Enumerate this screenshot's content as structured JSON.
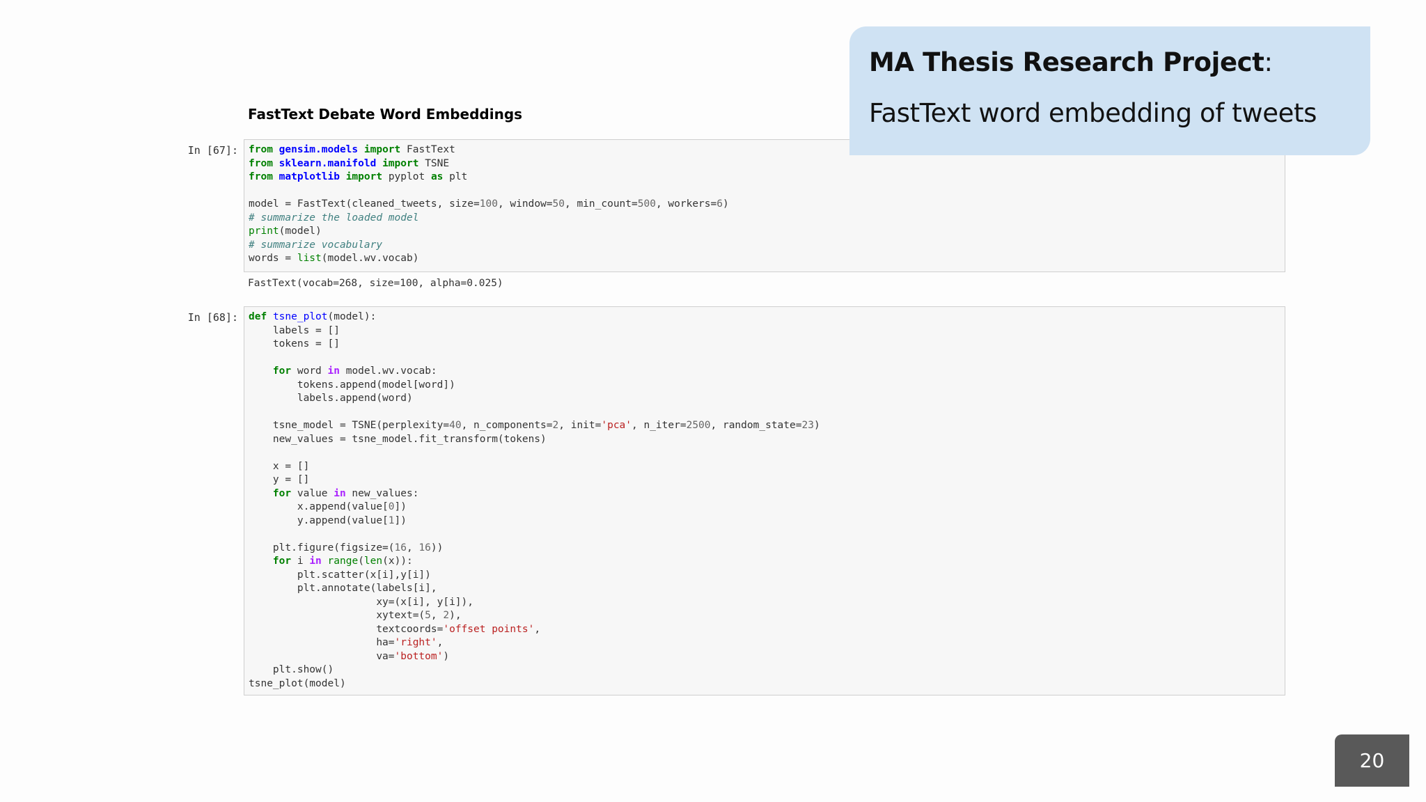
{
  "notebook": {
    "heading": "FastText Debate Word Embeddings",
    "cells": [
      {
        "prompt": "In [67]:",
        "lines": [
          [
            [
              "kw",
              "from"
            ],
            [
              "pl",
              " "
            ],
            [
              "mod",
              "gensim.models"
            ],
            [
              "pl",
              " "
            ],
            [
              "kw",
              "import"
            ],
            [
              "pl",
              " FastText"
            ]
          ],
          [
            [
              "kw",
              "from"
            ],
            [
              "pl",
              " "
            ],
            [
              "mod",
              "sklearn.manifold"
            ],
            [
              "pl",
              " "
            ],
            [
              "kw",
              "import"
            ],
            [
              "pl",
              " TSNE"
            ]
          ],
          [
            [
              "kw",
              "from"
            ],
            [
              "pl",
              " "
            ],
            [
              "mod",
              "matplotlib"
            ],
            [
              "pl",
              " "
            ],
            [
              "kw",
              "import"
            ],
            [
              "pl",
              " pyplot "
            ],
            [
              "kw",
              "as"
            ],
            [
              "pl",
              " plt"
            ]
          ],
          [],
          [
            [
              "pl",
              "model = FastText(cleaned_tweets, size="
            ],
            [
              "nm",
              "100"
            ],
            [
              "pl",
              ", window="
            ],
            [
              "nm",
              "50"
            ],
            [
              "pl",
              ", min_count="
            ],
            [
              "nm",
              "500"
            ],
            [
              "pl",
              ", workers="
            ],
            [
              "nm",
              "6"
            ],
            [
              "pl",
              ")"
            ]
          ],
          [
            [
              "cm",
              "# summarize the loaded model"
            ]
          ],
          [
            [
              "bi",
              "print"
            ],
            [
              "pl",
              "(model)"
            ]
          ],
          [
            [
              "cm",
              "# summarize vocabulary"
            ]
          ],
          [
            [
              "pl",
              "words = "
            ],
            [
              "bi",
              "list"
            ],
            [
              "pl",
              "(model.wv.vocab)"
            ]
          ]
        ],
        "output": "FastText(vocab=268, size=100, alpha=0.025)"
      },
      {
        "prompt": "In [68]:",
        "lines": [
          [
            [
              "kw",
              "def"
            ],
            [
              "pl",
              " "
            ],
            [
              "fn",
              "tsne_plot"
            ],
            [
              "pl",
              "(model):"
            ]
          ],
          [
            [
              "pl",
              "    labels = []"
            ]
          ],
          [
            [
              "pl",
              "    tokens = []"
            ]
          ],
          [],
          [
            [
              "pl",
              "    "
            ],
            [
              "kw",
              "for"
            ],
            [
              "pl",
              " word "
            ],
            [
              "ops",
              "in"
            ],
            [
              "pl",
              " model.wv.vocab:"
            ]
          ],
          [
            [
              "pl",
              "        tokens.append(model[word])"
            ]
          ],
          [
            [
              "pl",
              "        labels.append(word)"
            ]
          ],
          [],
          [
            [
              "pl",
              "    tsne_model = TSNE(perplexity="
            ],
            [
              "nm",
              "40"
            ],
            [
              "pl",
              ", n_components="
            ],
            [
              "nm",
              "2"
            ],
            [
              "pl",
              ", init="
            ],
            [
              "str",
              "'pca'"
            ],
            [
              "pl",
              ", n_iter="
            ],
            [
              "nm",
              "2500"
            ],
            [
              "pl",
              ", random_state="
            ],
            [
              "nm",
              "23"
            ],
            [
              "pl",
              ")"
            ]
          ],
          [
            [
              "pl",
              "    new_values = tsne_model.fit_transform(tokens)"
            ]
          ],
          [],
          [
            [
              "pl",
              "    x = []"
            ]
          ],
          [
            [
              "pl",
              "    y = []"
            ]
          ],
          [
            [
              "pl",
              "    "
            ],
            [
              "kw",
              "for"
            ],
            [
              "pl",
              " value "
            ],
            [
              "ops",
              "in"
            ],
            [
              "pl",
              " new_values:"
            ]
          ],
          [
            [
              "pl",
              "        x.append(value["
            ],
            [
              "nm",
              "0"
            ],
            [
              "pl",
              "])"
            ]
          ],
          [
            [
              "pl",
              "        y.append(value["
            ],
            [
              "nm",
              "1"
            ],
            [
              "pl",
              "])"
            ]
          ],
          [],
          [
            [
              "pl",
              "    plt.figure(figsize=("
            ],
            [
              "nm",
              "16"
            ],
            [
              "pl",
              ", "
            ],
            [
              "nm",
              "16"
            ],
            [
              "pl",
              "))"
            ]
          ],
          [
            [
              "pl",
              "    "
            ],
            [
              "kw",
              "for"
            ],
            [
              "pl",
              " i "
            ],
            [
              "ops",
              "in"
            ],
            [
              "pl",
              " "
            ],
            [
              "bi",
              "range"
            ],
            [
              "pl",
              "("
            ],
            [
              "bi",
              "len"
            ],
            [
              "pl",
              "(x)):"
            ]
          ],
          [
            [
              "pl",
              "        plt.scatter(x[i],y[i])"
            ]
          ],
          [
            [
              "pl",
              "        plt.annotate(labels[i],"
            ]
          ],
          [
            [
              "pl",
              "                     xy=(x[i], y[i]),"
            ]
          ],
          [
            [
              "pl",
              "                     xytext=("
            ],
            [
              "nm",
              "5"
            ],
            [
              "pl",
              ", "
            ],
            [
              "nm",
              "2"
            ],
            [
              "pl",
              "),"
            ]
          ],
          [
            [
              "pl",
              "                     textcoords="
            ],
            [
              "str",
              "'offset points'"
            ],
            [
              "pl",
              ","
            ]
          ],
          [
            [
              "pl",
              "                     ha="
            ],
            [
              "str",
              "'right'"
            ],
            [
              "pl",
              ","
            ]
          ],
          [
            [
              "pl",
              "                     va="
            ],
            [
              "str",
              "'bottom'"
            ],
            [
              "pl",
              ")"
            ]
          ],
          [
            [
              "pl",
              "    plt.show()"
            ]
          ],
          [
            [
              "pl",
              "tsne_plot(model)"
            ]
          ]
        ]
      }
    ]
  },
  "slide": {
    "title_bold": "MA Thesis Research Project",
    "title_colon": ":",
    "subtitle": "FastText word embedding of tweets",
    "page_number": "20"
  },
  "colors": {
    "title_box_bg": "#cfe2f3",
    "page_number_bg": "#595959",
    "cell_bg": "#f7f7f7"
  }
}
